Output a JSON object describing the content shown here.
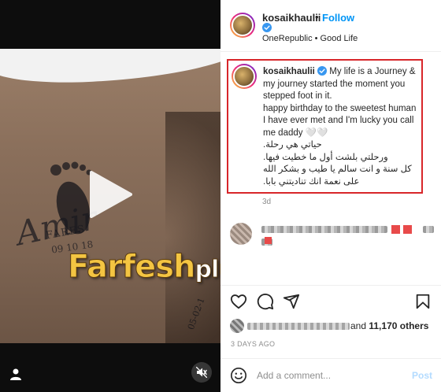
{
  "colors": {
    "follow_blue": "#0095f6",
    "verified_blue": "#3897f0",
    "highlight_red": "#d8262a",
    "post_disabled": "#b3dbff",
    "muted_text": "#8e8e8e"
  },
  "media": {
    "tattoo_name": "Amir",
    "tattoo_fares": "FARES",
    "tattoo_date": "09 10 18",
    "tattoo_side_text": "05-02-1",
    "watermark_main": "Farfesh",
    "watermark_plus": "plus.com",
    "icons": {
      "play": "play-icon",
      "user": "user-tag-icon",
      "mute": "mute-icon"
    }
  },
  "header": {
    "username": "kosaikhaulii",
    "separator": "•",
    "follow_label": "Follow",
    "audio": "OneRepublic • Good Life"
  },
  "caption": {
    "username": "kosaikhaulii",
    "line_en": "My life is a Journey & my journey started the moment you stepped foot in it.",
    "line_en2": "happy birthday to the sweetest human I have ever met and I'm lucky you call me daddy 🤍🤍",
    "line_ar1": "حياتي هي رحلة.",
    "line_ar2": "ورحلتي بلشت أول ما خطيت فيها.",
    "line_ar3": "كل سنة و انت سالم يا طيب و بشكر الله",
    "line_ar4": "على نعمة انك تناديتني بابا.",
    "time": "3d"
  },
  "likes": {
    "others_prefix": "and",
    "others_count": "11,170 others"
  },
  "time_ago": "3 DAYS AGO",
  "comment_box": {
    "placeholder": "Add a comment...",
    "post_label": "Post"
  },
  "action_icons": [
    "heart-icon",
    "comment-icon",
    "share-icon",
    "bookmark-icon"
  ]
}
